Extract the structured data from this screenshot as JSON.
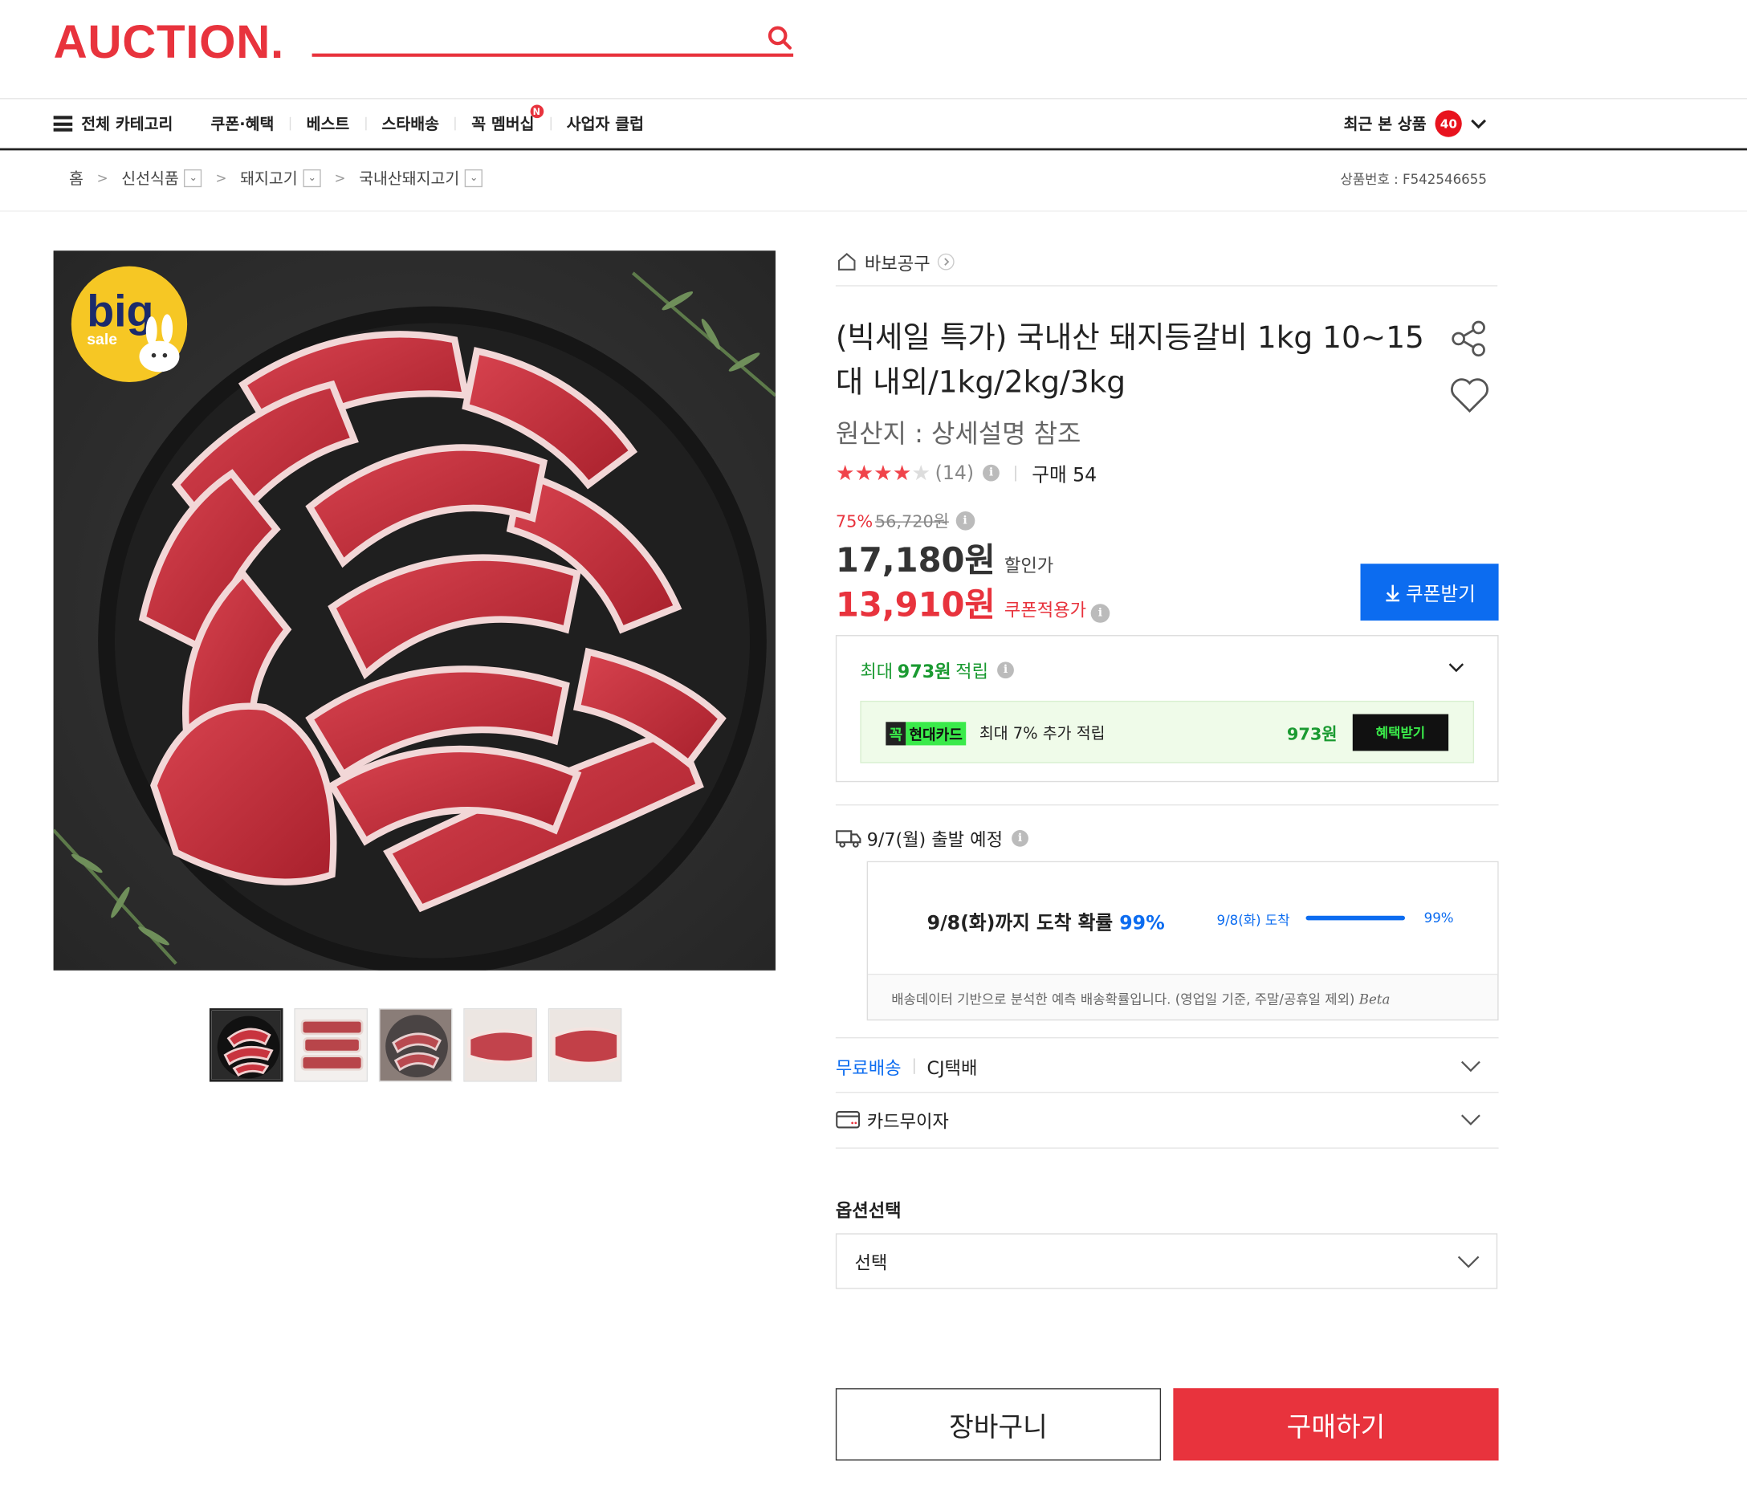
{
  "header": {
    "logo": "AUCTION.",
    "nav": {
      "all_category": "전체 카테고리",
      "items": [
        "쿠폰·혜택",
        "베스트",
        "스타배송",
        "꼭 멤버십",
        "사업자 클럽"
      ],
      "new_badge": "N"
    },
    "recent": {
      "label": "최근 본 상품",
      "count": "40"
    }
  },
  "breadcrumb": {
    "home": "홈",
    "items": [
      "신선식품",
      "돼지고기",
      "국내산돼지고기"
    ],
    "product_no": "상품번호 : F542546655"
  },
  "gallery": {
    "badge_big": "big",
    "badge_sale": "sale"
  },
  "product": {
    "store": "바보공구",
    "title": "(빅세일 특가) 국내산 돼지등갈비 1kg 10~15대 내외/1kg/2kg/3kg",
    "origin": "원산지 : 상세설명 참조",
    "rating_stars": 4,
    "review_count": "(14)",
    "purchase": "구매 54",
    "discount_pct": "75%",
    "original_price": "56,720원",
    "sale_price": "17,180원",
    "sale_label": "할인가",
    "coupon_price": "13,910원",
    "coupon_label": "쿠폰적용가",
    "coupon_button": "쿠폰받기"
  },
  "reward": {
    "title_prefix": "최대 ",
    "title_amount": "973원",
    "title_suffix": " 적립",
    "card_k": "꼭",
    "card_brand": "현대카드",
    "card_text": "최대 7% 추가 적립",
    "card_amount": "973원",
    "benefit_button": "혜택받기"
  },
  "shipping": {
    "depart": "9/7(월) 출발 예정",
    "arrive_text": "9/8(화)까지 도착 확률 ",
    "arrive_pct": "99%",
    "bar_label": "9/8(화) 도착",
    "bar_pct": "99%",
    "bar_value": 0.99,
    "note": "배송데이터 기반으로 분석한 예측 배송확률입니다. (영업일 기준, 주말/공휴일 제외)",
    "beta": "Beta",
    "free": "무료배송",
    "carrier": "CJ택배",
    "card_free": "카드무이자"
  },
  "options": {
    "label": "옵션선택",
    "select_value": "선택"
  },
  "actions": {
    "cart": "장바구니",
    "buy": "구매하기"
  },
  "colors": {
    "brand": "#e8333d",
    "blue": "#0c6cf0",
    "green": "#1a9a31"
  }
}
